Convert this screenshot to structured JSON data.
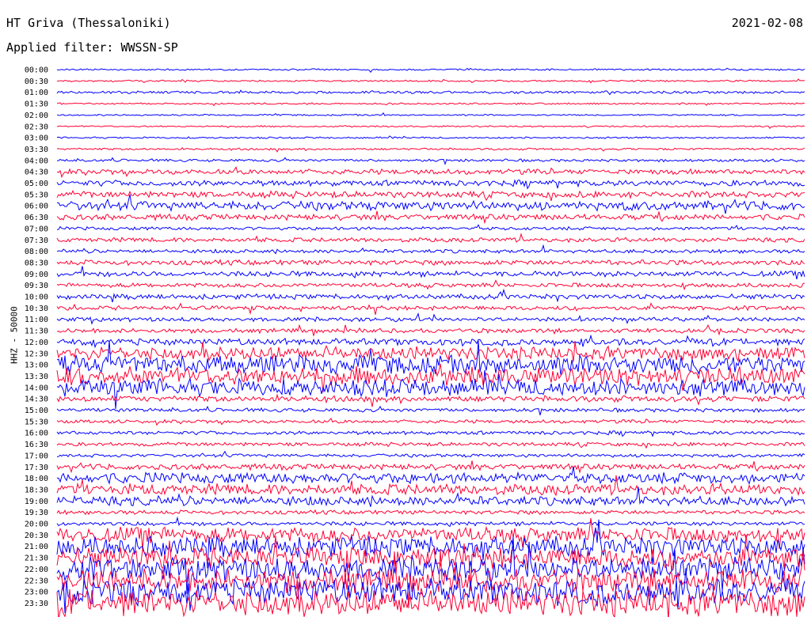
{
  "header": {
    "title": "HT Griva (Thessaloniki)",
    "date": "2021-02-08",
    "filter": "Applied filter: WWSSN-SP"
  },
  "chart_data": {
    "type": "line",
    "title": "HT Griva (Thessaloniki)",
    "subtitle": "Applied filter: WWSSN-SP",
    "date": "2021-02-08",
    "ylabel": "HHZ - 50000",
    "xlabel": "",
    "series": [
      {
        "name": "",
        "color": "#0000ff"
      },
      {
        "name": "",
        "color": "#ff0033"
      }
    ],
    "rows": [
      {
        "time": "00:00",
        "amp": 1.0
      },
      {
        "time": "00:30",
        "amp": 1.0
      },
      {
        "time": "01:00",
        "amp": 1.5
      },
      {
        "time": "01:30",
        "amp": 1.0
      },
      {
        "time": "02:00",
        "amp": 0.9
      },
      {
        "time": "02:30",
        "amp": 0.9
      },
      {
        "time": "03:00",
        "amp": 1.0
      },
      {
        "time": "03:30",
        "amp": 1.2
      },
      {
        "time": "04:00",
        "amp": 1.6
      },
      {
        "time": "04:30",
        "amp": 3.0
      },
      {
        "time": "05:00",
        "amp": 3.5
      },
      {
        "time": "05:30",
        "amp": 3.8
      },
      {
        "time": "06:00",
        "amp": 5.5
      },
      {
        "time": "06:30",
        "amp": 3.5
      },
      {
        "time": "07:00",
        "amp": 2.0
      },
      {
        "time": "07:30",
        "amp": 2.6
      },
      {
        "time": "08:00",
        "amp": 2.2
      },
      {
        "time": "08:30",
        "amp": 3.0
      },
      {
        "time": "09:00",
        "amp": 3.2
      },
      {
        "time": "09:30",
        "amp": 2.6
      },
      {
        "time": "10:00",
        "amp": 3.0
      },
      {
        "time": "10:30",
        "amp": 2.6
      },
      {
        "time": "11:00",
        "amp": 2.4
      },
      {
        "time": "11:30",
        "amp": 2.6
      },
      {
        "time": "12:00",
        "amp": 4.0
      },
      {
        "time": "12:30",
        "amp": 8.0
      },
      {
        "time": "13:00",
        "amp": 11.0
      },
      {
        "time": "13:30",
        "amp": 11.0
      },
      {
        "time": "14:00",
        "amp": 10.0
      },
      {
        "time": "14:30",
        "amp": 3.5
      },
      {
        "time": "15:00",
        "amp": 2.2
      },
      {
        "time": "15:30",
        "amp": 2.0
      },
      {
        "time": "16:00",
        "amp": 2.2
      },
      {
        "time": "16:30",
        "amp": 2.2
      },
      {
        "time": "17:00",
        "amp": 2.0
      },
      {
        "time": "17:30",
        "amp": 3.5
      },
      {
        "time": "18:00",
        "amp": 6.5
      },
      {
        "time": "18:30",
        "amp": 6.5
      },
      {
        "time": "19:00",
        "amp": 5.5
      },
      {
        "time": "19:30",
        "amp": 2.4
      },
      {
        "time": "20:00",
        "amp": 2.4
      },
      {
        "time": "20:30",
        "amp": 9.0
      },
      {
        "time": "21:00",
        "amp": 12.0
      },
      {
        "time": "21:30",
        "amp": 13.0
      },
      {
        "time": "22:00",
        "amp": 14.0
      },
      {
        "time": "22:30",
        "amp": 14.0
      },
      {
        "time": "23:00",
        "amp": 15.0
      },
      {
        "time": "23:30",
        "amp": 16.0
      }
    ]
  }
}
